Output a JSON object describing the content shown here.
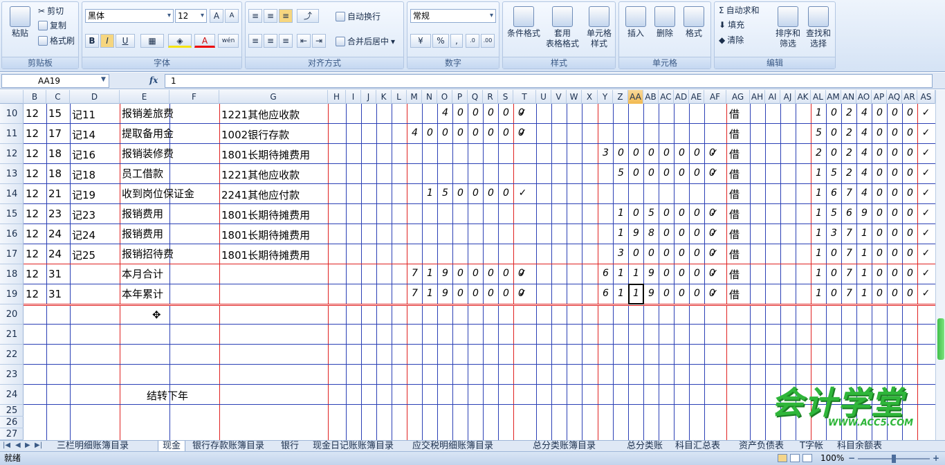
{
  "ribbon": {
    "clipboard": {
      "paste": "粘贴",
      "cut": "剪切",
      "copy": "复制",
      "format_painter": "格式刷",
      "caption": "剪贴板"
    },
    "font": {
      "name": "黑体",
      "size": "12",
      "bold": "B",
      "italic": "I",
      "underline": "U",
      "phonetic": "wén",
      "caption": "字体"
    },
    "alignment": {
      "wrap": "自动换行",
      "merge": "合并后居中",
      "caption": "对齐方式"
    },
    "number": {
      "format": "常规",
      "percent": "%",
      "comma": ",",
      "caption": "数字"
    },
    "styles": {
      "cond": "条件格式",
      "table1": "套用",
      "table2": "表格格式",
      "cell1": "单元格",
      "cell2": "样式",
      "caption": "样式"
    },
    "cells": {
      "insert": "插入",
      "delete": "删除",
      "format": "格式",
      "caption": "单元格"
    },
    "editing": {
      "autosum": "自动求和",
      "fill": "填充",
      "clear": "清除",
      "sort1": "排序和",
      "sort2": "筛选",
      "find1": "查找和",
      "find2": "选择",
      "caption": "编辑"
    }
  },
  "formula_bar": {
    "name_box": "AA19",
    "fx": "fx",
    "value": "1"
  },
  "columns": [
    "B",
    "C",
    "D",
    "E",
    "F",
    "G",
    "H",
    "I",
    "J",
    "K",
    "L",
    "M",
    "N",
    "O",
    "P",
    "Q",
    "R",
    "S",
    "T",
    "U",
    "V",
    "W",
    "X",
    "Y",
    "Z",
    "AA",
    "AB",
    "AC",
    "AD",
    "AE",
    "AF",
    "AG",
    "AH",
    "AI",
    "AJ",
    "AK",
    "AL",
    "AM",
    "AN",
    "AO",
    "AP",
    "AQ",
    "AR",
    "AS"
  ],
  "active_column": "AA",
  "row_numbers": [
    "10",
    "11",
    "12",
    "13",
    "14",
    "15",
    "16",
    "17",
    "18",
    "19",
    "20",
    "21",
    "22",
    "23",
    "24",
    "25",
    "26",
    "27"
  ],
  "rows": [
    {
      "month": "12",
      "day": "15",
      "voucher": "记11",
      "summary": "报销差旅费",
      "account": "1221其他应收款",
      "debit": [
        "",
        "",
        "4",
        "0",
        "0",
        "0",
        "0",
        "0"
      ],
      "debit_check": "✓",
      "credit": [
        "",
        "",
        "",
        "",
        "",
        "",
        "",
        ""
      ],
      "credit_check": "",
      "dir": "借",
      "balance": [
        "1",
        "0",
        "2",
        "4",
        "0",
        "0",
        "0"
      ],
      "bal_check": "✓"
    },
    {
      "month": "12",
      "day": "17",
      "voucher": "记14",
      "summary": "提取备用金",
      "account": "1002银行存款",
      "debit": [
        "4",
        "0",
        "0",
        "0",
        "0",
        "0",
        "0",
        "0"
      ],
      "debit_check": "✓",
      "credit": [
        "",
        "",
        "",
        "",
        "",
        "",
        "",
        ""
      ],
      "credit_check": "",
      "dir": "借",
      "balance": [
        "5",
        "0",
        "2",
        "4",
        "0",
        "0",
        "0"
      ],
      "bal_check": "✓"
    },
    {
      "month": "12",
      "day": "18",
      "voucher": "记16",
      "summary": "报销装修费",
      "account": "1801长期待摊费用",
      "debit": [
        "",
        "",
        "",
        "",
        "",
        "",
        "",
        ""
      ],
      "debit_check": "",
      "credit": [
        "3",
        "0",
        "0",
        "0",
        "0",
        "0",
        "0",
        "0"
      ],
      "credit_check": "✓",
      "dir": "借",
      "balance": [
        "2",
        "0",
        "2",
        "4",
        "0",
        "0",
        "0"
      ],
      "bal_check": "✓"
    },
    {
      "month": "12",
      "day": "18",
      "voucher": "记18",
      "summary": "员工借款",
      "account": "1221其他应收款",
      "debit": [
        "",
        "",
        "",
        "",
        "",
        "",
        "",
        ""
      ],
      "debit_check": "",
      "credit": [
        "",
        "5",
        "0",
        "0",
        "0",
        "0",
        "0",
        "0"
      ],
      "credit_check": "✓",
      "dir": "借",
      "balance": [
        "1",
        "5",
        "2",
        "4",
        "0",
        "0",
        "0"
      ],
      "bal_check": "✓"
    },
    {
      "month": "12",
      "day": "21",
      "voucher": "记19",
      "summary": "收到岗位保证金",
      "account": "2241其他应付款",
      "debit": [
        "",
        "1",
        "5",
        "0",
        "0",
        "0",
        "0",
        ""
      ],
      "debit_check": "✓",
      "credit": [
        "",
        "",
        "",
        "",
        "",
        "",
        "",
        ""
      ],
      "credit_check": "",
      "dir": "借",
      "balance": [
        "1",
        "6",
        "7",
        "4",
        "0",
        "0",
        "0"
      ],
      "bal_check": "✓"
    },
    {
      "month": "12",
      "day": "23",
      "voucher": "记23",
      "summary": "报销费用",
      "account": "1801长期待摊费用",
      "debit": [
        "",
        "",
        "",
        "",
        "",
        "",
        "",
        ""
      ],
      "debit_check": "",
      "credit": [
        "",
        "1",
        "0",
        "5",
        "0",
        "0",
        "0",
        "0"
      ],
      "credit_check": "✓",
      "dir": "借",
      "balance": [
        "1",
        "5",
        "6",
        "9",
        "0",
        "0",
        "0"
      ],
      "bal_check": "✓"
    },
    {
      "month": "12",
      "day": "24",
      "voucher": "记24",
      "summary": "报销费用",
      "account": "1801长期待摊费用",
      "debit": [
        "",
        "",
        "",
        "",
        "",
        "",
        "",
        ""
      ],
      "debit_check": "",
      "credit": [
        "",
        "1",
        "9",
        "8",
        "0",
        "0",
        "0",
        "0"
      ],
      "credit_check": "✓",
      "dir": "借",
      "balance": [
        "1",
        "3",
        "7",
        "1",
        "0",
        "0",
        "0"
      ],
      "bal_check": "✓"
    },
    {
      "month": "12",
      "day": "24",
      "voucher": "记25",
      "summary": "报销招待费",
      "account": "1801长期待摊费用",
      "debit": [
        "",
        "",
        "",
        "",
        "",
        "",
        "",
        ""
      ],
      "debit_check": "",
      "credit": [
        "",
        "3",
        "0",
        "0",
        "0",
        "0",
        "0",
        "0"
      ],
      "credit_check": "✓",
      "dir": "借",
      "balance": [
        "1",
        "0",
        "7",
        "1",
        "0",
        "0",
        "0"
      ],
      "bal_check": "✓"
    },
    {
      "month": "12",
      "day": "31",
      "voucher": "",
      "summary": "本月合计",
      "account": "",
      "debit": [
        "7",
        "1",
        "9",
        "0",
        "0",
        "0",
        "0",
        "0"
      ],
      "debit_check": "✓",
      "credit": [
        "6",
        "1",
        "1",
        "9",
        "0",
        "0",
        "0",
        "0"
      ],
      "credit_check": "✓",
      "dir": "借",
      "balance": [
        "1",
        "0",
        "7",
        "1",
        "0",
        "0",
        "0"
      ],
      "bal_check": "✓"
    },
    {
      "month": "12",
      "day": "31",
      "voucher": "",
      "summary": "本年累计",
      "account": "",
      "debit": [
        "7",
        "1",
        "9",
        "0",
        "0",
        "0",
        "0",
        "0"
      ],
      "debit_check": "✓",
      "credit": [
        "6",
        "1",
        "1",
        "9",
        "0",
        "0",
        "0",
        "0"
      ],
      "credit_check": "✓",
      "dir": "借",
      "balance": [
        "1",
        "0",
        "7",
        "1",
        "0",
        "0",
        "0"
      ],
      "bal_check": "✓"
    }
  ],
  "carry_forward": "结转下年",
  "sheet_tabs": [
    "三栏明细账簿目录",
    "现金",
    "银行存款账簿目录",
    "银行",
    "现金日记账账簿目录",
    "应交税明细账簿目录",
    "总分类账簿目录",
    "总分类账",
    "科目汇总表",
    "资产负债表",
    "T字帐",
    "科目余额表"
  ],
  "active_tab": "现金",
  "status": {
    "ready": "就绪",
    "zoom": "100%"
  },
  "watermark": {
    "brand": "会计学堂",
    "url": "WWW.ACC5.COM"
  }
}
